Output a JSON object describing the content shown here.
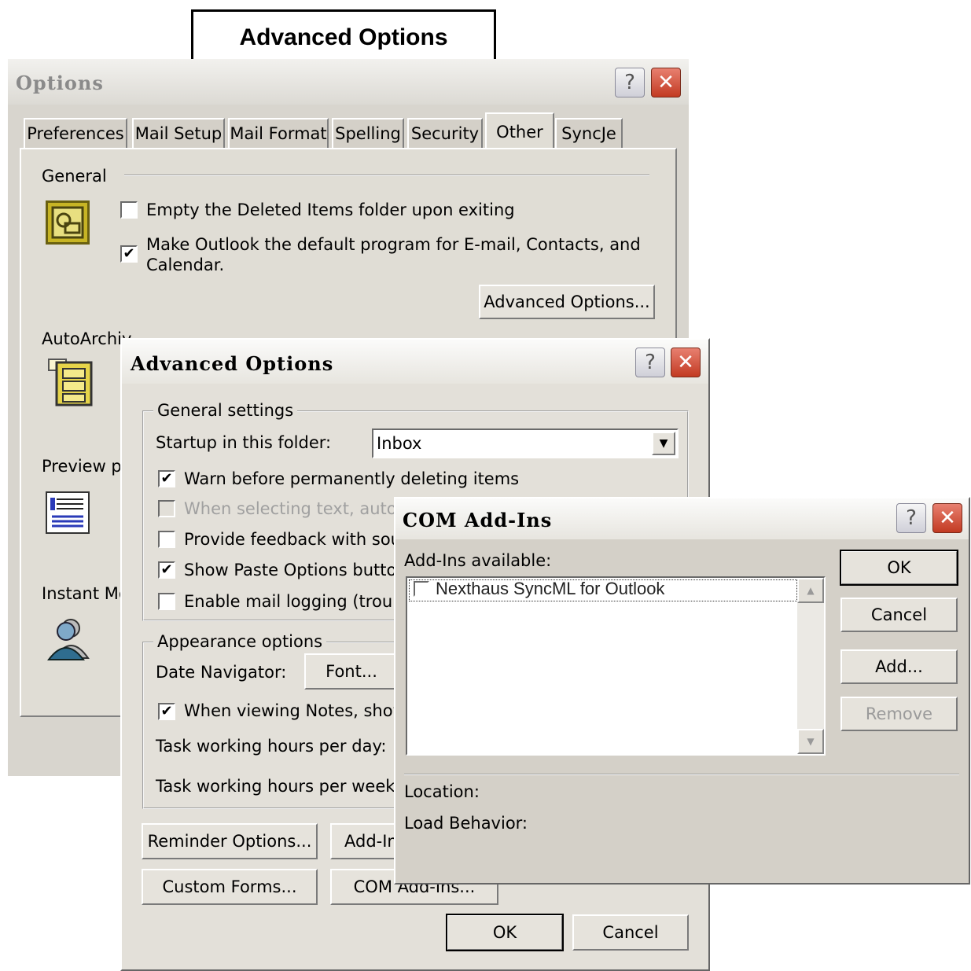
{
  "callout": {
    "title": "Advanced Options"
  },
  "options_window": {
    "title": "Options",
    "tabs": [
      "Preferences",
      "Mail Setup",
      "Mail Format",
      "Spelling",
      "Security",
      "Other",
      "SyncJe"
    ],
    "selected_tab": "Other",
    "general": {
      "heading": "General",
      "empty_deleted_label": "Empty the Deleted Items folder upon exiting",
      "empty_deleted_checked": false,
      "default_program_label_1": "Make Outlook the default program for E-mail, Contacts, and",
      "default_program_label_2": "Calendar.",
      "default_program_checked": true,
      "advanced_button": "Advanced Options..."
    },
    "autoarchive_heading": "AutoArchiv",
    "preview_heading": "Preview pa",
    "instant_heading": "Instant Me"
  },
  "advanced_window": {
    "title": "Advanced Options",
    "general_group": "General settings",
    "startup_label": "Startup in this folder:",
    "startup_value": "Inbox",
    "warn_label": "Warn before permanently deleting items",
    "warn_checked": true,
    "select_label": "When selecting text, autom",
    "feedback_label": "Provide feedback with soun",
    "paste_label": "Show Paste Options buttons",
    "paste_checked": true,
    "logging_label": "Enable mail logging (trouble",
    "appearance_group": "Appearance options",
    "date_nav_label": "Date Navigator:",
    "font_button": "Font...",
    "notes_label": "When viewing Notes, show",
    "notes_checked": true,
    "task_day_label": "Task working hours per day:",
    "task_week_label": "Task working hours per week:",
    "reminder_button": "Reminder Options...",
    "addin_button": "Add-In",
    "custom_forms_button": "Custom Forms...",
    "com_button": "COM Add-Ins...",
    "ok_button": "OK",
    "cancel_button": "Cancel"
  },
  "com_window": {
    "title": "COM Add-Ins",
    "available_label": "Add-Ins available:",
    "items": [
      {
        "label": "Nexthaus SyncML for Outlook",
        "checked": false
      }
    ],
    "ok_button": "OK",
    "cancel_button": "Cancel",
    "add_button": "Add...",
    "remove_button": "Remove",
    "location_label": "Location:",
    "load_behavior_label": "Load Behavior:"
  }
}
